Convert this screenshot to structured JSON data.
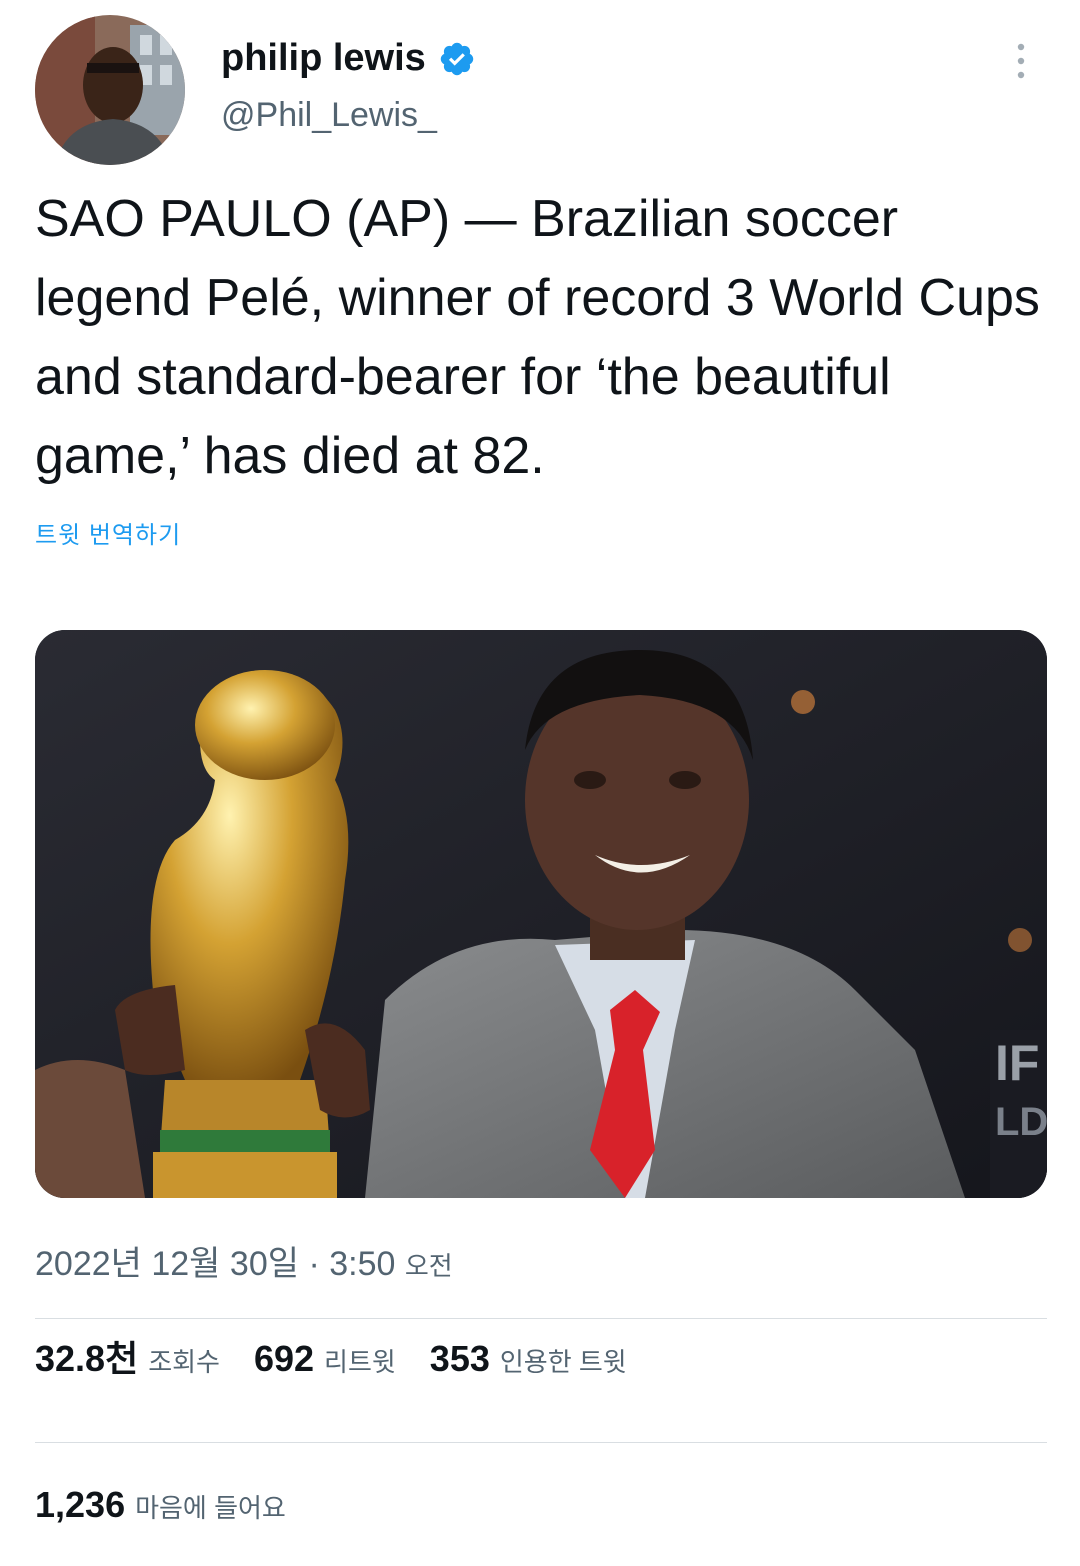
{
  "author": {
    "display_name": "philip lewis",
    "handle": "@Phil_Lewis_",
    "verified": true,
    "avatar": "avatar-photo"
  },
  "tweet": {
    "text": "SAO PAULO (AP) — Brazilian soccer legend Pelé, winner of record 3 World Cups and standard-bearer for ‘the beautiful game,’ has died at 82.",
    "translate_label": "트윗 번역하기",
    "media": "photo of Pelé holding the World Cup trophy",
    "timestamp_date": "2022년 12월 30일",
    "timestamp_sep": " · ",
    "timestamp_time": "3:50",
    "timestamp_ampm": "오전"
  },
  "stats": {
    "views_num": "32.8천",
    "views_label": "조회수",
    "retweets_num": "692",
    "retweets_label": "리트윗",
    "quotes_num": "353",
    "quotes_label": "인용한 트윗",
    "likes_num": "1,236",
    "likes_label": "마음에 들어요"
  },
  "colors": {
    "text": "#0f1419",
    "secondary": "#536471",
    "link": "#1d9bf0",
    "verified": "#1d9bf0",
    "divider": "#d9dee2"
  },
  "icons": [
    "verified-badge-icon",
    "more-options-icon"
  ]
}
